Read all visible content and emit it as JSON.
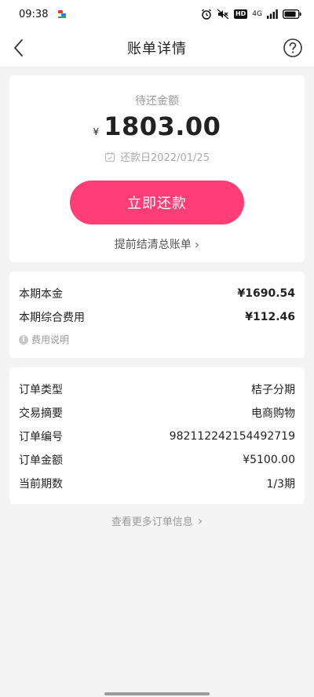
{
  "status_bar": {
    "time": "09:38",
    "hd_badge": "HD",
    "signal_label": "4G",
    "icons": [
      "alarm-icon",
      "mute-icon",
      "hd-icon",
      "signal-icon",
      "battery-icon"
    ]
  },
  "nav": {
    "title": "账单详情",
    "back_icon": "chevron-left-icon",
    "help_icon": "help-circle-icon"
  },
  "due": {
    "label": "待还金额",
    "currency": "¥",
    "amount": "1803.00",
    "date_text": "还款日2022/01/25",
    "pay_button_label": "立即还款",
    "settle_link": "提前结清总账单",
    "settle_arrow": "›"
  },
  "fees": {
    "principal_label": "本期本金",
    "principal_value": "¥1690.54",
    "fee_label": "本期综合费用",
    "fee_value": "¥112.46",
    "fee_note": "费用说明",
    "info_glyph": "i"
  },
  "order": {
    "rows": [
      {
        "label": "订单类型",
        "value": "桔子分期"
      },
      {
        "label": "交易摘要",
        "value": "电商购物"
      },
      {
        "label": "订单编号",
        "value": "982112242154492719"
      },
      {
        "label": "订单金额",
        "value": "¥5100.00"
      },
      {
        "label": "当前期数",
        "value": "1/3期"
      }
    ]
  },
  "more_link": {
    "label": "查看更多订单信息",
    "arrow": "›"
  },
  "colors": {
    "accent": "#ff3e77",
    "background": "#f4f4f4",
    "card": "#ffffff",
    "muted_text": "#999999"
  }
}
